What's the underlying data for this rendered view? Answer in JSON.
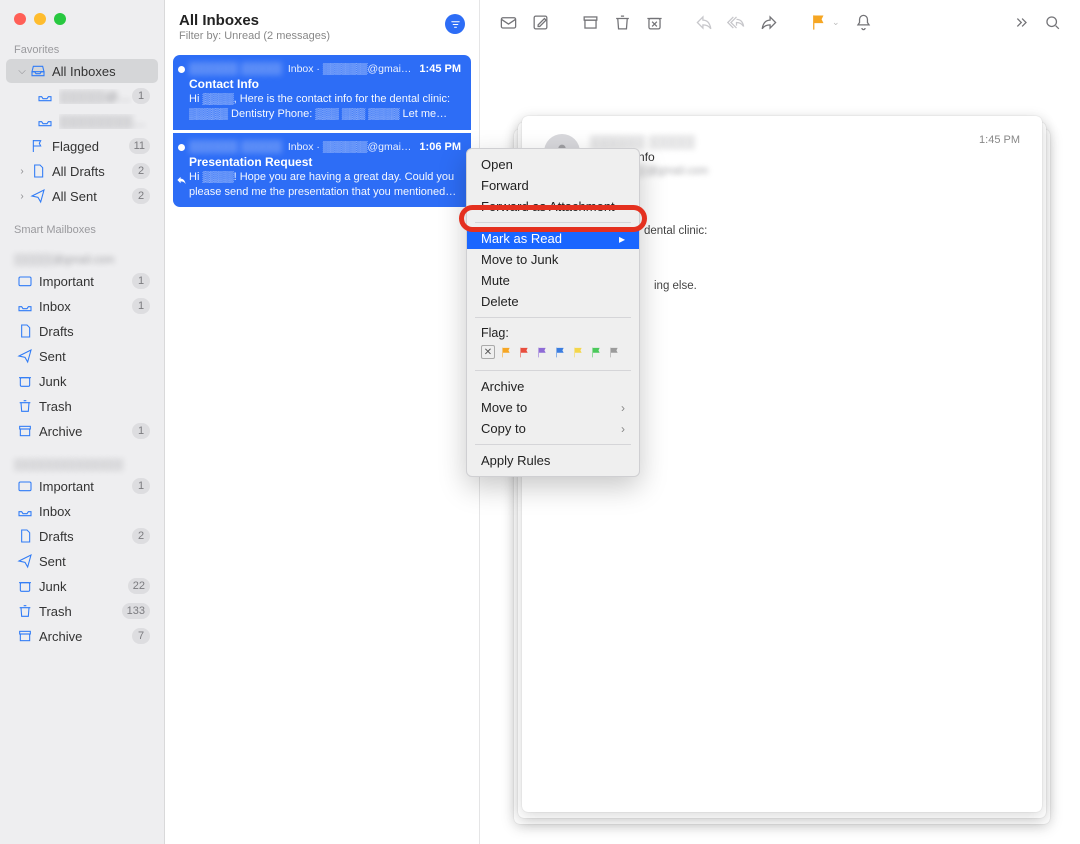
{
  "window": {
    "title": "All Inboxes",
    "filter_sub": "Filter by: Unread (2 messages)"
  },
  "sidebar": {
    "sections": {
      "favorites": "Favorites",
      "smart": "Smart Mailboxes",
      "acct1": "▒▒▒▒▒@gmail.com",
      "acct2": "▒▒▒▒▒▒▒▒▒▒▒▒▒▒"
    },
    "items": {
      "all_inboxes": "All Inboxes",
      "acct1_inbox": "▒▒▒▒▒@g…",
      "acct1_badge": "1",
      "acct2_inbox": "▒▒▒▒▒▒▒▒▒▒▒▒▒",
      "flagged": "Flagged",
      "flagged_badge": "11",
      "all_drafts": "All Drafts",
      "all_drafts_badge": "2",
      "all_sent": "All Sent",
      "all_sent_badge": "2",
      "important": "Important",
      "important_badge": "1",
      "inbox": "Inbox",
      "inbox_badge": "1",
      "drafts": "Drafts",
      "sent": "Sent",
      "junk": "Junk",
      "trash": "Trash",
      "archive": "Archive",
      "archive_badge": "1",
      "important2": "Important",
      "important2_badge": "1",
      "inbox2": "Inbox",
      "drafts2": "Drafts",
      "drafts2_badge": "2",
      "sent2": "Sent",
      "junk2": "Junk",
      "junk2_badge": "22",
      "trash2": "Trash",
      "trash2_badge": "133",
      "archive2": "Archive",
      "archive2_badge": "7"
    }
  },
  "messages": [
    {
      "from": "▒▒▒▒▒▒ ▒▒▒▒▒",
      "mailbox": "Inbox · ▒▒▒▒▒▒@gmail.com",
      "time": "1:45 PM",
      "subject": "Contact Info",
      "preview": "Hi ▒▒▒▒, Here is the contact info for the dental clinic: ▒▒▒▒▒ Dentistry Phone: ▒▒▒ ▒▒▒ ▒▒▒▒ Let me know if you need anyt…"
    },
    {
      "from": "▒▒▒▒▒▒ ▒▒▒▒▒",
      "mailbox": "Inbox · ▒▒▒▒▒▒@gmail.com",
      "time": "1:06 PM",
      "subject": "Presentation Request",
      "preview": "Hi ▒▒▒▒! Hope you are having a great day. Could you please send me the presentation that you mentioned today? I would l…"
    }
  ],
  "preview": {
    "from": "▒▒▒▒▒▒ ▒▒▒▒▒",
    "subject": "Contact Info",
    "to_label": "To:",
    "to_value": "▒▒▒▒▒@gmail.com",
    "time": "1:45 PM",
    "frag1": "dental clinic:",
    "frag2": "ing else."
  },
  "context_menu": {
    "open": "Open",
    "forward": "Forward",
    "forward_attach": "Forward as Attachment",
    "mark_read": "Mark as Read",
    "move_junk": "Move to Junk",
    "mute": "Mute",
    "delete": "Delete",
    "flag_label": "Flag:",
    "archive": "Archive",
    "move_to": "Move to",
    "copy_to": "Copy to",
    "apply_rules": "Apply Rules",
    "flag_colors": [
      "#f6a623",
      "#e84d3d",
      "#8e6bd6",
      "#3a7de0",
      "#3ac5e0",
      "#4bc95b",
      "#9b9b9b"
    ]
  },
  "toolbar": {
    "icons": [
      "mail-unread",
      "compose",
      "archive",
      "trash",
      "junk",
      "reply",
      "reply-all",
      "forward",
      "flag",
      "notify"
    ]
  }
}
